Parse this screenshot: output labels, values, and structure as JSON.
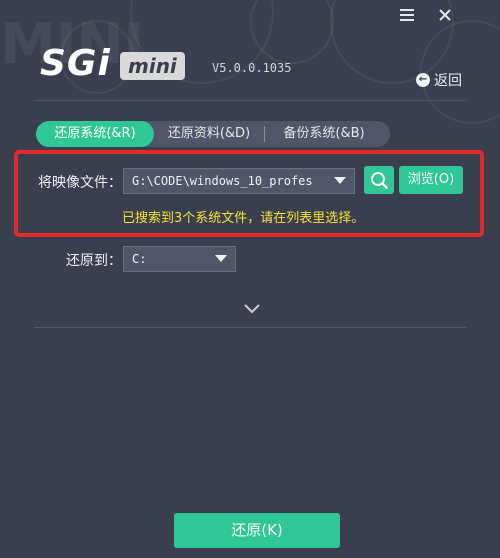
{
  "app": {
    "logo_watermark": "MINI",
    "logo_main": "SGi",
    "logo_sub": "mini",
    "version": "V5.0.0.1035",
    "menu_icon": "hamburger-menu-icon",
    "close_icon": "close-icon"
  },
  "nav": {
    "back_label": "返回",
    "back_icon": "back-arrow-circle-icon"
  },
  "tabs": [
    {
      "label": "还原系统(&R)",
      "active": true
    },
    {
      "label": "还原资料(&D)",
      "active": false
    },
    {
      "label": "备份系统(&B)",
      "active": false
    }
  ],
  "image_file": {
    "label": "将映像文件：",
    "value": "G:\\CODE\\windows_10_profes",
    "search_icon": "search-icon",
    "browse_label": "浏览(O)"
  },
  "hint": "已搜索到3个系统文件，请在列表里选择。",
  "restore_to": {
    "label": "还原到：",
    "value": "C:"
  },
  "expand_icon": "chevron-down-icon",
  "restore_button_label": "还原(K)",
  "colors": {
    "background": "#3a3e4f",
    "accent": "#2ec795",
    "highlight_border": "#e22a2a",
    "hint_text": "#f2e534"
  }
}
